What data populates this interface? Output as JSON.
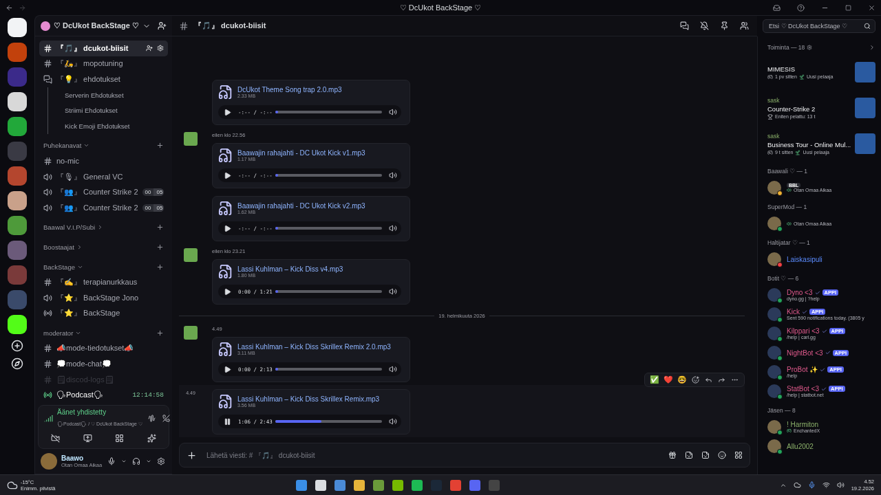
{
  "title_bar": {
    "title": "♡ DcUkot BackStage ♡"
  },
  "sidebar": {
    "server_name": "♡ DcUkot BackStage ♡",
    "items": [
      {
        "kind": "text",
        "label": "『🎵』 dcukot-biisit",
        "selected": true
      },
      {
        "kind": "text",
        "label": "『🛵』 mopotuning",
        "selected": false
      },
      {
        "kind": "forum",
        "label": "『💡』 ehdotukset",
        "selected": false,
        "children": [
          {
            "label": "Serverin Ehdotukset"
          },
          {
            "label": "Striimi Ehdotukset"
          },
          {
            "label": "Kick Emoji Ehdotukset"
          }
        ]
      },
      {
        "kind": "category",
        "label": "Puhekanavat",
        "expanded": true
      },
      {
        "kind": "text",
        "label": "no-mic",
        "selected": false
      },
      {
        "kind": "voice",
        "label": "『🎙』 General VC",
        "selected": false
      },
      {
        "kind": "voice",
        "label": "『👥』 Counter Strike 2",
        "selected": false,
        "counts": [
          "00",
          "05"
        ]
      },
      {
        "kind": "voice",
        "label": "『👥』 Counter Strike 2",
        "selected": false,
        "counts": [
          "00",
          "05"
        ]
      },
      {
        "kind": "category",
        "label": "Baawal V.I.P/Subi",
        "expanded": false
      },
      {
        "kind": "category",
        "label": "Boostaajat",
        "expanded": false
      },
      {
        "kind": "category",
        "label": "BackStage",
        "expanded": true
      },
      {
        "kind": "text",
        "label": "『✍』 terapianurkkaus",
        "selected": false
      },
      {
        "kind": "voice",
        "label": "『⭐』 BackStage Jono",
        "selected": false
      },
      {
        "kind": "stage",
        "label": "『⭐』 BackStage",
        "selected": false
      },
      {
        "kind": "category",
        "label": "moderator",
        "expanded": true
      },
      {
        "kind": "text",
        "label": "📣mode-tiedotukset📣",
        "selected": false
      },
      {
        "kind": "text",
        "label": "💭mode-chat💭",
        "selected": false
      },
      {
        "kind": "text",
        "label": "🗒discod-logs🗒",
        "selected": false,
        "muted": true
      },
      {
        "kind": "stage",
        "label": "🗣Podcast🗣",
        "selected": false,
        "time": "12:14:58"
      }
    ],
    "voice_panel": {
      "status": "Äänet yhdistetty",
      "location": "🗣Podcast🗣 / ♡ DcUkot BackStage ♡"
    },
    "user": {
      "name": "Baawo",
      "status": "Otan Omaa Aikaa"
    }
  },
  "channel_header": {
    "name": "『🎵』 dcukot-biisit",
    "search": {
      "placeholder": "Etsi ♡ DcUkot BackStage ♡"
    }
  },
  "messages": [
    {
      "kind": "group",
      "attachments": [
        {
          "name": "DcUkot Theme Song trap 2.0.mp3",
          "size": "2.33 MB",
          "time": "-:-- / -:--",
          "playing": false,
          "level": 0.0
        }
      ]
    },
    {
      "kind": "group",
      "time": "eilen klo 22.56",
      "attachments": [
        {
          "name": "Baawajin rahajahti - DC Ukot Kick v1.mp3",
          "size": "1.17 MB",
          "time": "-:-- / -:--",
          "playing": false,
          "level": 0.0
        },
        {
          "name": "Baawajin rahajahti - DC Ukot Kick v2.mp3",
          "size": "1.62 MB",
          "time": "-:-- / -:--",
          "playing": false,
          "level": 0.0
        }
      ]
    },
    {
      "kind": "group",
      "time": "eilen klo 23.21",
      "attachments": [
        {
          "name": "Lassi Kuhlman – Kick Diss v4.mp3",
          "size": "1.80 MB",
          "time": "0:00 / 1:21",
          "playing": false,
          "level": 0.0
        }
      ]
    },
    {
      "kind": "divider",
      "label": "19. helmikuuta 2026"
    },
    {
      "kind": "group",
      "time": "4.49",
      "attachments": [
        {
          "name": "Lassi Kuhlman – Kick Diss Skrillex Remix 2.0.mp3",
          "size": "3.11 MB",
          "time": "0:00 / 2:13",
          "playing": false,
          "level": 0.0
        }
      ]
    },
    {
      "kind": "continuation",
      "time": "4.49",
      "hovered": true,
      "reactions": [
        "✅",
        "❤️",
        "🤓"
      ],
      "attachments": [
        {
          "name": "Lassi Kuhlman – Kick Diss Skrillex Remix.mp3",
          "size": "3.56 MB",
          "time": "1:06 / 2:43",
          "playing": true,
          "level": 0.43
        }
      ]
    }
  ],
  "composer": {
    "placeholder": "Lähetä viesti: # 『🎵』 dcukot-biisit"
  },
  "members": {
    "activity_title": "Toiminta — 18",
    "activity": [
      {
        "kind": "played",
        "game": "MIMESIS",
        "meta": "1 pv sitten",
        "tag": "Uusi pelaaja"
      },
      {
        "kind": "most_played",
        "user": "sask",
        "game": "Counter-Strike 2",
        "meta": "Eniten pelattu: 13 t"
      },
      {
        "kind": "played",
        "user": "sask",
        "game": "Business Tour - Online Mul...",
        "meta": "9 t sitten",
        "tag": "Uusi pelaaja"
      }
    ],
    "groups": [
      {
        "title": "Baawali ♡ — 1",
        "members": [
          {
            "badge": "BBL",
            "sub": "Otan Omaa Aikaa",
            "color": "#f0b232",
            "kind": "voice"
          }
        ]
      },
      {
        "title": "SuperMod — 1",
        "members": [
          {
            "sub": "Otan Omaa Aikaa",
            "color": "#23a55a",
            "kind": "voice"
          }
        ]
      },
      {
        "title": "Haltijatar ♡ — 1",
        "members": [
          {
            "name": "Laiskasipuli",
            "color": "#f23f43",
            "kind": "plain"
          }
        ]
      },
      {
        "title": "Botit ♡ — 6",
        "members": [
          {
            "name": "Dyno <3",
            "app": "APPI",
            "sub": "dyno.gg | ?help",
            "color": "#23a55a",
            "kind": "bot"
          },
          {
            "name": "Kick",
            "app": "APPI",
            "sub": "Sent 590 notifications today. (3805 y",
            "color": "#23a55a",
            "kind": "bot"
          },
          {
            "name": "Kilppari <3",
            "app": "APPI",
            "sub": "/help | carl.gg",
            "color": "#23a55a",
            "kind": "bot"
          },
          {
            "name": "NightBot <3",
            "app": "APPI",
            "color": "#23a55a",
            "kind": "bot"
          },
          {
            "name": "ProBot ✨",
            "app": "APPI",
            "sub": "/help",
            "color": "#23a55a",
            "kind": "bot"
          },
          {
            "name": "StatBot <3",
            "app": "APPI",
            "sub": "/help | statbot.net",
            "color": "#23a55a",
            "kind": "bot"
          }
        ]
      },
      {
        "title": "Jäsen — 8",
        "members": [
          {
            "name": "! Harmiton",
            "sub": "EnchantedX",
            "color": "#23a55a",
            "kind": "game"
          },
          {
            "name": "Allu2002",
            "color": "#23a55a",
            "kind": "plain"
          }
        ]
      }
    ]
  },
  "taskbar": {
    "weather": {
      "temp": "-15°C",
      "text": "Enimm. pilvistä"
    },
    "clock": {
      "time": "4.52",
      "date": "19.2.2026"
    }
  }
}
